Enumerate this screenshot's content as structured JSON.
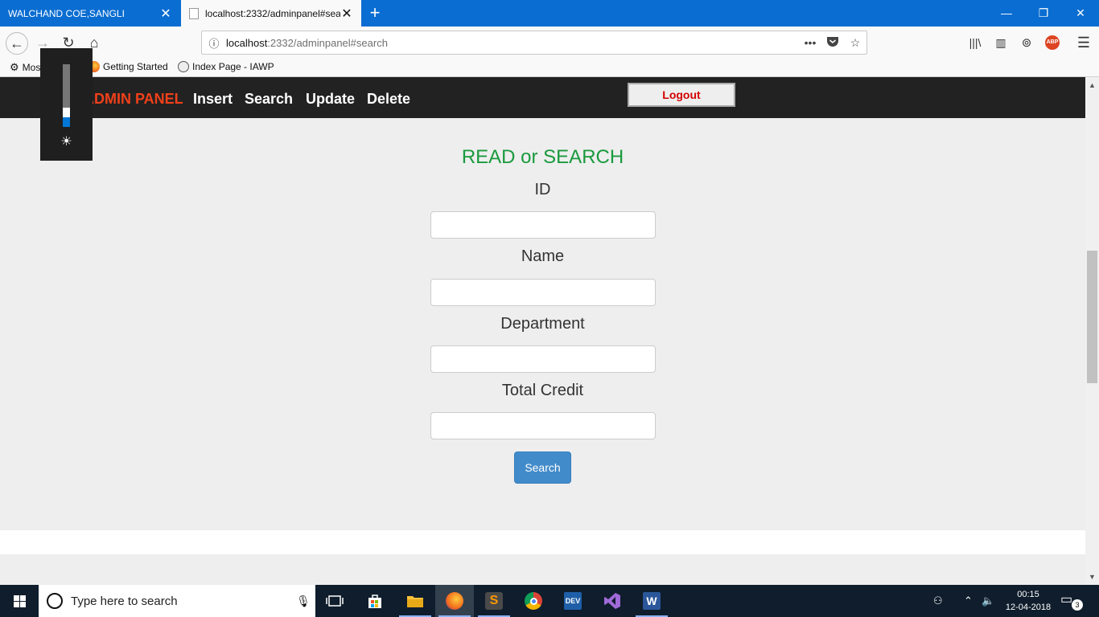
{
  "browser": {
    "tabs": [
      {
        "title": "WALCHAND COE,SANGLI",
        "active": false
      },
      {
        "title": "localhost:2332/adminpanel#sea",
        "active": true
      }
    ],
    "new_tab_label": "+",
    "url_host": "localhost",
    "url_rest": ":2332/adminpanel#search",
    "bookmarks": [
      {
        "label": "Most Visited",
        "icon": "gear-icon"
      },
      {
        "label": "Getting Started",
        "icon": "firefox-icon"
      },
      {
        "label": "Index Page - IAWP",
        "icon": "globe-icon"
      }
    ],
    "abp_label": "ABP"
  },
  "site_nav": {
    "brand": "ADMIN PANEL",
    "links": [
      "Insert",
      "Search",
      "Update",
      "Delete"
    ],
    "logout_label": "Logout"
  },
  "form": {
    "title": "READ or SEARCH",
    "fields": [
      {
        "label": "ID",
        "value": ""
      },
      {
        "label": "Name",
        "value": ""
      },
      {
        "label": "Department",
        "value": ""
      },
      {
        "label": "Total Credit",
        "value": ""
      }
    ],
    "submit_label": "Search"
  },
  "brightness_overlay": {
    "level": 0.3
  },
  "taskbar": {
    "search_placeholder": "Type here to search",
    "apps": [
      "task-view",
      "store",
      "file-explorer",
      "firefox",
      "sublime-text",
      "chrome",
      "dev-cpp",
      "visual-studio",
      "word"
    ],
    "clock_time": "00:15",
    "clock_date": "12-04-2018",
    "notification_count": "3"
  },
  "colors": {
    "tab_bar": "#0a6dd1",
    "site_nav_bg": "#222222",
    "brand": "#f0401a",
    "form_title": "#1a9a3c",
    "button": "#428bca",
    "logout_text": "#d40000",
    "taskbar": "#0f1d2c"
  }
}
